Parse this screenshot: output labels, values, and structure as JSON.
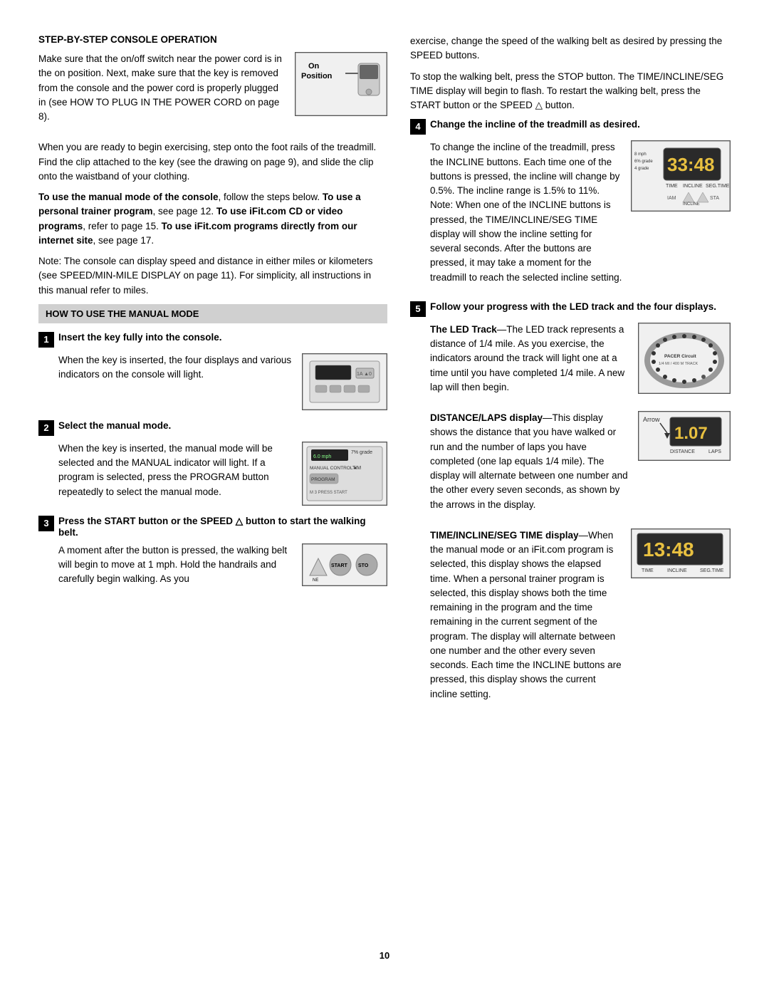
{
  "page": {
    "number": "10",
    "left_column": {
      "section_title": "STEP-BY-STEP CONSOLE OPERATION",
      "intro_paragraphs": [
        "Make sure that the on/off switch near the power cord is in the on position. Next, make sure that the key is removed from the console and the power cord is properly plugged in (see HOW TO PLUG IN THE POWER CORD on page 8).",
        "When you are ready to begin exercising, step onto the foot rails of the treadmill. Find the clip attached to the key (see the drawing on page 9), and slide the clip onto the waistband of your clothing.",
        "To use the manual mode of the console, follow the steps below. To use a personal trainer program, see page 12. To use iFit.com CD or video programs, refer to page 15. To use iFit.com programs directly from our internet site, see page 17.",
        "Note: The console can display speed and distance in either miles or kilometers (see SPEED/MIN-MILE DISPLAY on page 11). For simplicity, all instructions in this manual refer to miles."
      ],
      "manual_mode_header": "HOW TO USE THE MANUAL MODE",
      "step1_header": "Insert the key fully into the console.",
      "step1_body": "When the key is inserted, the four displays and various indicators on the console will light.",
      "step2_header": "Select the manual mode.",
      "step2_body": "When the key is inserted, the manual mode will be selected and the MANUAL indicator will light. If a program is selected, press the PROGRAM button repeatedly to select the manual mode.",
      "step3_header": "Press the START button or the SPEED △ button to start the walking belt.",
      "step3_body": "A moment after the button is pressed, the walking belt will begin to move at 1 mph. Hold the handrails and carefully begin walking. As you"
    },
    "right_column": {
      "intro_paragraphs": [
        "exercise, change the speed of the walking belt as desired by pressing the SPEED buttons.",
        "To stop the walking belt, press the STOP button. The TIME/INCLINE/SEG TIME display will begin to flash. To restart the walking belt, press the START button or the SPEED △ button."
      ],
      "step4_header": "Change the incline of the treadmill as desired.",
      "step4_body": "To change the incline of the treadmill, press the INCLINE buttons. Each time one of the buttons is pressed, the incline will change by 0.5%. The incline range is 1.5% to 11%. Note: When one of the INCLINE buttons is pressed, the TIME/INCLINE/SEG TIME display will show the incline setting for several seconds. After the buttons are pressed, it may take a moment for the treadmill to reach the selected incline setting.",
      "step5_header": "Follow your progress with the LED track and the four displays.",
      "step5_led_header": "The LED Track",
      "step5_led_body": "—The LED track represents a distance of 1/4 mile. As you exercise, the indicators around the track will light one at a time until you have completed 1/4 mile. A new lap will then begin.",
      "step5_distance_header": "DISTANCE/LAPS display",
      "step5_distance_body": "—This display shows the distance that you have walked or run and the number of laps you have completed (one lap equals 1/4 mile). The display will alternate between one number and the other every seven seconds, as shown by the arrows in the display.",
      "step5_time_header": "TIME/INCLINE/SEG TIME display",
      "step5_time_body": "—When the manual mode or an iFit.com program is selected, this display shows the elapsed time. When a personal trainer program is selected, this display shows both the time remaining in the program and the time remaining in the current segment of the program. The display will alternate between one number and the other every seven seconds. Each time the INCLINE buttons are pressed, this display shows the current incline setting.",
      "arrow_label": "Arrow",
      "distance_label": "DISTANCE",
      "laps_label": "LAPS",
      "time_label": "TIME",
      "incline_label": "INCLINE",
      "seg_time_label": "SEG.TIME",
      "display_33_48": "33:48",
      "display_1_07": "1.07",
      "display_13_48": "13:48"
    }
  }
}
